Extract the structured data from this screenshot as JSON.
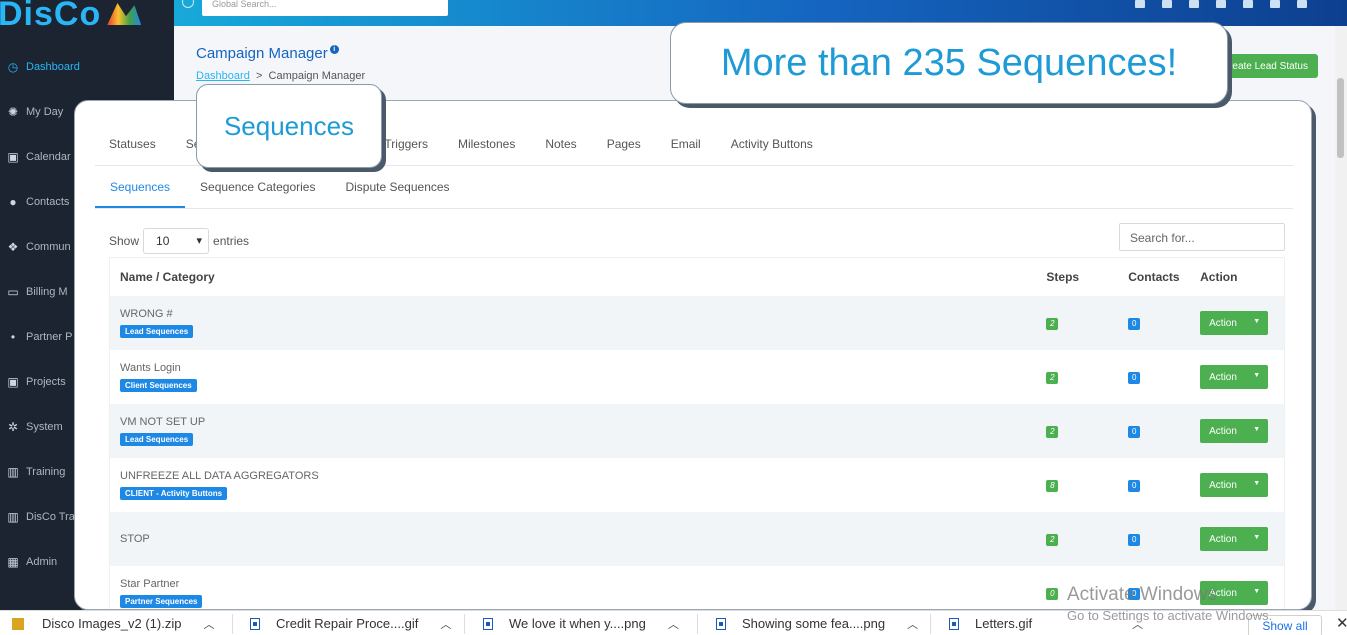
{
  "brand": {
    "logo_text": "DisCo"
  },
  "topbar": {
    "search_placeholder": "Global Search..."
  },
  "sidebar": {
    "items": [
      {
        "label": "Dashboard",
        "icon": "dashboard-icon",
        "active": true
      },
      {
        "label": "My Day",
        "icon": "sun-icon"
      },
      {
        "label": "Calendar",
        "icon": "calendar-icon"
      },
      {
        "label": "Contacts",
        "icon": "user-icon"
      },
      {
        "label": "Commun",
        "icon": "chat-icon"
      },
      {
        "label": "Billing M",
        "icon": "card-icon"
      },
      {
        "label": "Partner P",
        "icon": "partner-icon"
      },
      {
        "label": "Projects",
        "icon": "projects-icon"
      },
      {
        "label": "System",
        "icon": "gear-icon"
      },
      {
        "label": "Training",
        "icon": "book-icon"
      },
      {
        "label": "DisCo Tra",
        "icon": "book-icon"
      },
      {
        "label": "Admin",
        "icon": "grid-icon"
      }
    ]
  },
  "header": {
    "title": "Campaign Manager",
    "breadcrumb_home": "Dashboard",
    "breadcrumb_sep": ">",
    "breadcrumb_current": "Campaign Manager",
    "create_button": "Create Lead Status"
  },
  "callouts": {
    "big": "More than 235 Sequences!",
    "small": "Sequences"
  },
  "tabs": {
    "top": [
      "Statuses",
      "Se",
      "Triggers",
      "Milestones",
      "Notes",
      "Pages",
      "Email",
      "Activity Buttons"
    ],
    "sub": [
      "Sequences",
      "Sequence Categories",
      "Dispute Sequences"
    ],
    "active_sub": 0
  },
  "table_controls": {
    "show_label": "Show",
    "entries_value": "10",
    "entries_label": "entries",
    "search_placeholder": "Search for..."
  },
  "table": {
    "headers": [
      "Name / Category",
      "Steps",
      "Contacts",
      "Action"
    ],
    "rows": [
      {
        "name": "WRONG #",
        "category": "Lead Sequences",
        "steps": "2",
        "contacts": "0",
        "action": "Action"
      },
      {
        "name": "Wants Login",
        "category": "Client Sequences",
        "steps": "2",
        "contacts": "0",
        "action": "Action"
      },
      {
        "name": "VM NOT SET UP",
        "category": "Lead Sequences",
        "steps": "2",
        "contacts": "0",
        "action": "Action"
      },
      {
        "name": "UNFREEZE ALL DATA AGGREGATORS",
        "category": "CLIENT - Activity Buttons",
        "steps": "8",
        "contacts": "0",
        "action": "Action"
      },
      {
        "name": "STOP",
        "category": "",
        "steps": "2",
        "contacts": "0",
        "action": "Action"
      },
      {
        "name": "Star Partner",
        "category": "Partner Sequences",
        "steps": "0",
        "contacts": "0",
        "action": "Action"
      }
    ]
  },
  "watermark": {
    "line1": "Activate Windows",
    "line2": "Go to Settings to activate Windows."
  },
  "downloads": {
    "items": [
      "Disco Images_v2 (1).zip",
      "Credit Repair Proce....gif",
      "We love it when y....png",
      "Showing some fea....png",
      "Letters.gif"
    ],
    "show_all": "Show all"
  },
  "colors": {
    "accent": "#1e88e5",
    "success": "#4caf50",
    "sidebar_bg": "#1b2430",
    "callout_text": "#1e9bd7"
  }
}
